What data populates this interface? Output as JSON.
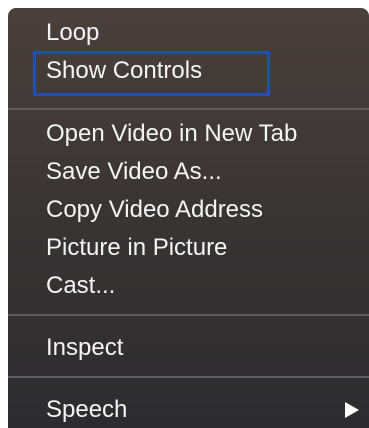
{
  "context_menu": {
    "groups": [
      {
        "items": [
          {
            "label": "Loop"
          },
          {
            "label": "Show Controls"
          }
        ]
      },
      {
        "items": [
          {
            "label": "Open Video in New Tab"
          },
          {
            "label": "Save Video As..."
          },
          {
            "label": "Copy Video Address"
          },
          {
            "label": "Picture in Picture"
          },
          {
            "label": "Cast..."
          }
        ]
      },
      {
        "items": [
          {
            "label": "Inspect"
          }
        ]
      },
      {
        "items": [
          {
            "label": "Speech",
            "has_submenu": true,
            "submenu_icon": "triangle-right-icon"
          }
        ]
      }
    ]
  },
  "colors": {
    "menu_background": "#3a3535",
    "text": "#f4f4f4",
    "separator": "#5c5a5b",
    "highlight_outline": "#1f4fb8"
  }
}
